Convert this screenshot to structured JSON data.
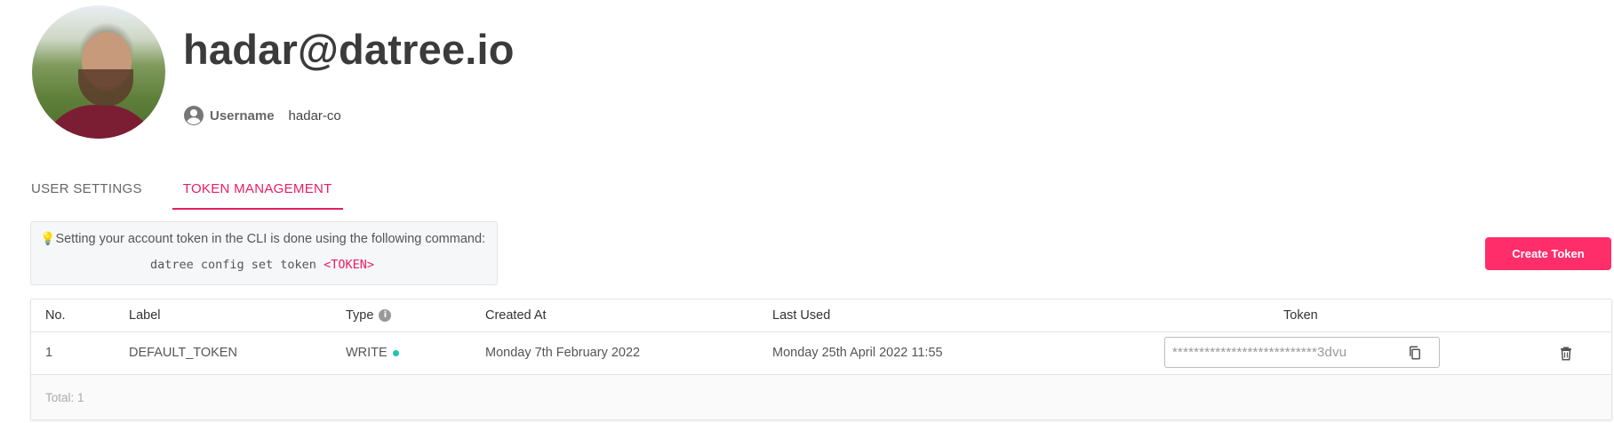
{
  "profile": {
    "email": "hadar@datree.io",
    "username_label": "Username",
    "username_value": "hadar-co",
    "icons": {
      "user": "account-circle-icon",
      "avatar": "profile-photo"
    }
  },
  "tabs": [
    {
      "label": "USER SETTINGS",
      "active": false
    },
    {
      "label": "TOKEN MANAGEMENT",
      "active": true
    }
  ],
  "hint": {
    "icon": "lightbulb-icon",
    "text": "Setting your account token in the CLI is done using the following command:",
    "command": "datree config set token",
    "command_token": "<TOKEN>"
  },
  "actions": {
    "create_token": "Create Token"
  },
  "colors": {
    "accent": "#e91e63",
    "button": "#ff2e6b",
    "status_dot": "#1cc8b0"
  },
  "table": {
    "headers": {
      "no": "No.",
      "label": "Label",
      "type": "Type",
      "created_at": "Created At",
      "last_used": "Last Used",
      "token": "Token"
    },
    "rows": [
      {
        "no": "1",
        "label": "DEFAULT_TOKEN",
        "type": "WRITE",
        "created_at": "Monday 7th February 2022",
        "last_used": "Monday 25th April 2022 11:55",
        "token": "***************************3dvu"
      }
    ],
    "footer": "Total: 1"
  }
}
